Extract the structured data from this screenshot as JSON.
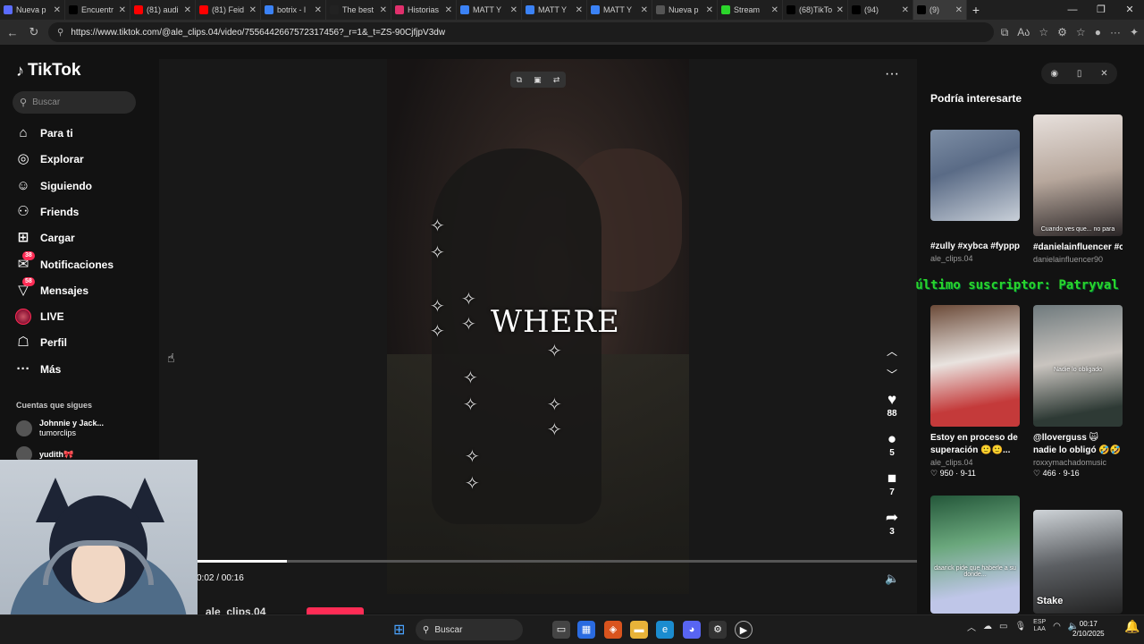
{
  "browser": {
    "tabs": [
      {
        "label": "Nueva p",
        "color": "#5b6cff",
        "icon": "page-icon"
      },
      {
        "label": "Encuentr",
        "color": "#000000",
        "icon": "tiktok-icon"
      },
      {
        "label": "(81) audi",
        "color": "#ff0000",
        "icon": "youtube-icon"
      },
      {
        "label": "(81) Feid",
        "color": "#ff0000",
        "icon": "youtube-icon"
      },
      {
        "label": "botrix - l",
        "color": "#3b82f6",
        "icon": "search-icon"
      },
      {
        "label": "The best",
        "color": "#222222",
        "icon": "page-icon"
      },
      {
        "label": "Historias",
        "color": "#e1306c",
        "icon": "instagram-icon"
      },
      {
        "label": "MATT Y",
        "color": "#3b82f6",
        "icon": "search-icon"
      },
      {
        "label": "MATT Y",
        "color": "#3b82f6",
        "icon": "search-icon"
      },
      {
        "label": "MATT Y",
        "color": "#3b82f6",
        "icon": "search-icon"
      },
      {
        "label": "Nueva p",
        "color": "#555555",
        "icon": "page-icon"
      },
      {
        "label": "Stream",
        "color": "#2bd52b",
        "icon": "kick-icon"
      },
      {
        "label": "(68)TikTo",
        "color": "#000000",
        "icon": "tiktok-icon"
      },
      {
        "label": "(94)",
        "color": "#000000",
        "icon": "tiktok-icon"
      },
      {
        "label": "(9)",
        "color": "#000000",
        "icon": "tiktok-icon"
      }
    ],
    "new_tab": "+",
    "url": "https://www.tiktok.com/@ale_clips.04/video/7556442667572317456?_r=1&_t=ZS-90CjfjpV3dw"
  },
  "sidebar": {
    "logo": "TikTok",
    "search_placeholder": "Buscar",
    "items": [
      {
        "label": "Para ti",
        "icon": "home-icon",
        "glyph": "⌂",
        "badge": ""
      },
      {
        "label": "Explorar",
        "icon": "compass-icon",
        "glyph": "◎",
        "badge": ""
      },
      {
        "label": "Siguiendo",
        "icon": "following-icon",
        "glyph": "☺",
        "badge": ""
      },
      {
        "label": "Friends",
        "icon": "friends-icon",
        "glyph": "⚇",
        "badge": ""
      },
      {
        "label": "Cargar",
        "icon": "upload-icon",
        "glyph": "⊞",
        "badge": ""
      },
      {
        "label": "Notificaciones",
        "icon": "notifications-icon",
        "glyph": "✉",
        "badge": "38"
      },
      {
        "label": "Mensajes",
        "icon": "messages-icon",
        "glyph": "▽",
        "badge": "58"
      },
      {
        "label": "LIVE",
        "icon": "live-icon",
        "glyph": "",
        "badge": ""
      },
      {
        "label": "Perfil",
        "icon": "profile-icon",
        "glyph": "☖",
        "badge": ""
      },
      {
        "label": "Más",
        "icon": "more-icon",
        "glyph": "···",
        "badge": ""
      }
    ],
    "following_header": "Cuentas que sigues",
    "following": [
      {
        "name": "Johnnie y Jack...",
        "handle": "tumorclips"
      },
      {
        "name": "yudith🎀",
        "handle": ""
      }
    ]
  },
  "video": {
    "lyric": "WHERE",
    "time": "0:02 / 00:16",
    "progress": 0.125,
    "likes": "88",
    "comments": "5",
    "saves": "7",
    "shares": "3",
    "author": "ale_clips.04"
  },
  "right_panel": {
    "title": "Podría interesarte",
    "overlay_text": "último suscriptor: Patryval",
    "cards": [
      {
        "caption": "#zully #xybca #fyppppppppppp...",
        "author": "ale_clips.04",
        "stats": "",
        "thumb_text": ""
      },
      {
        "caption": "#danielainfluencer #contenidohoteles...",
        "author": "danielainfluencer90",
        "stats": "",
        "thumb_text": "Cuando ves que... no para"
      },
      {
        "caption": "Estoy en proceso de superación 🙂🙂...",
        "author": "ale_clips.04",
        "stats": "♡ 950 · 9-11",
        "thumb_text": ""
      },
      {
        "caption": "@lloverguss 🙀 nadie lo obligó 🤣🤣🤣...",
        "author": "roxxymachadomusic",
        "stats": "♡ 466 · 9-16",
        "thumb_text": "Nadie lo obligado"
      },
      {
        "caption": "",
        "author": "",
        "stats": "",
        "thumb_text": "daarick pide que haberle a su donde..."
      },
      {
        "caption": "",
        "author": "",
        "stats": "",
        "thumb_text": "Stake"
      }
    ]
  },
  "taskbar": {
    "search_label": "Buscar",
    "lang_top": "ESP",
    "lang_bottom": "LAA",
    "time": "00:17",
    "date": "2/10/2025"
  },
  "colors": {
    "accent": "#fe2c55",
    "overlay_green": "#2bd52b"
  }
}
